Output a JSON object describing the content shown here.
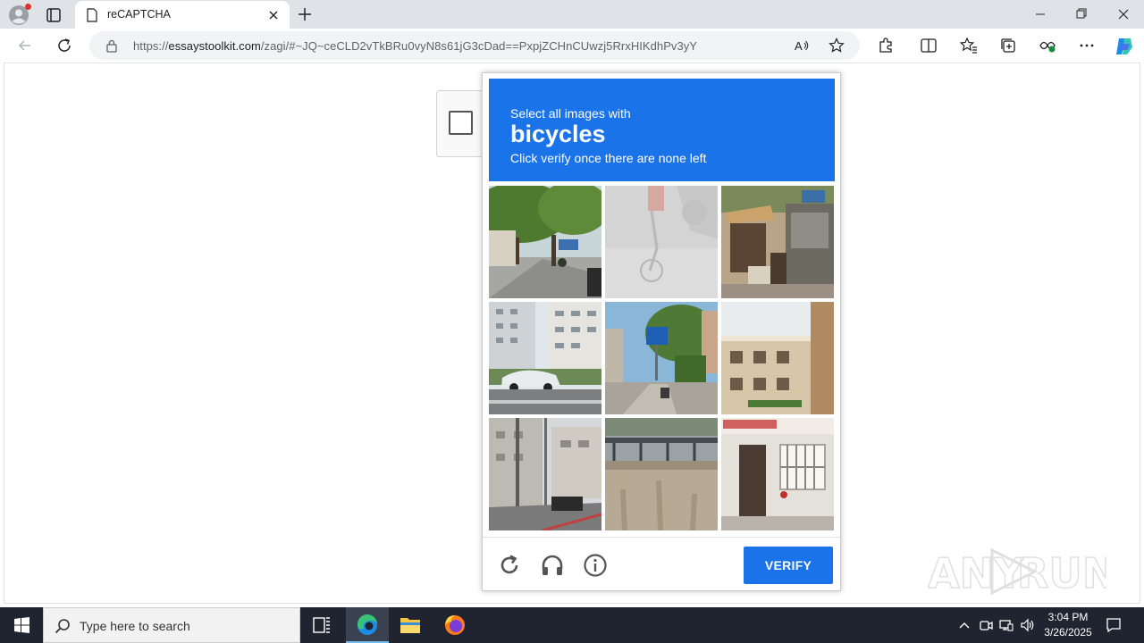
{
  "browser": {
    "tab_title": "reCAPTCHA",
    "url_prefix": "https://",
    "url_host": "essaystoolkit.com",
    "url_path": "/zagi/#~JQ~ceCLD2vTkBRu0vyN8s61jG3cDad==PxpjZCHnCUwzj5RrxHIKdhPv3yY"
  },
  "captcha": {
    "instruction_line1": "Select all images with",
    "target": "bicycles",
    "instruction_line3": "Click verify once there are none left",
    "verify_label": "VERIFY",
    "tiles": [
      {
        "scene": "street with trees and parked scooters"
      },
      {
        "scene": "faded image of cyclist"
      },
      {
        "scene": "street market stalls"
      },
      {
        "scene": "apartment buildings with white car"
      },
      {
        "scene": "street with blue sign and trees"
      },
      {
        "scene": "beige building facade"
      },
      {
        "scene": "urban street with utility poles"
      },
      {
        "scene": "concrete wall with railing"
      },
      {
        "scene": "building doorway with barred window"
      }
    ]
  },
  "watermark": "ANY RUN",
  "taskbar": {
    "search_placeholder": "Type here to search",
    "time": "3:04 PM",
    "date": "3/26/2025"
  },
  "colors": {
    "accent": "#1a73e8",
    "taskbar": "#1f2430"
  }
}
